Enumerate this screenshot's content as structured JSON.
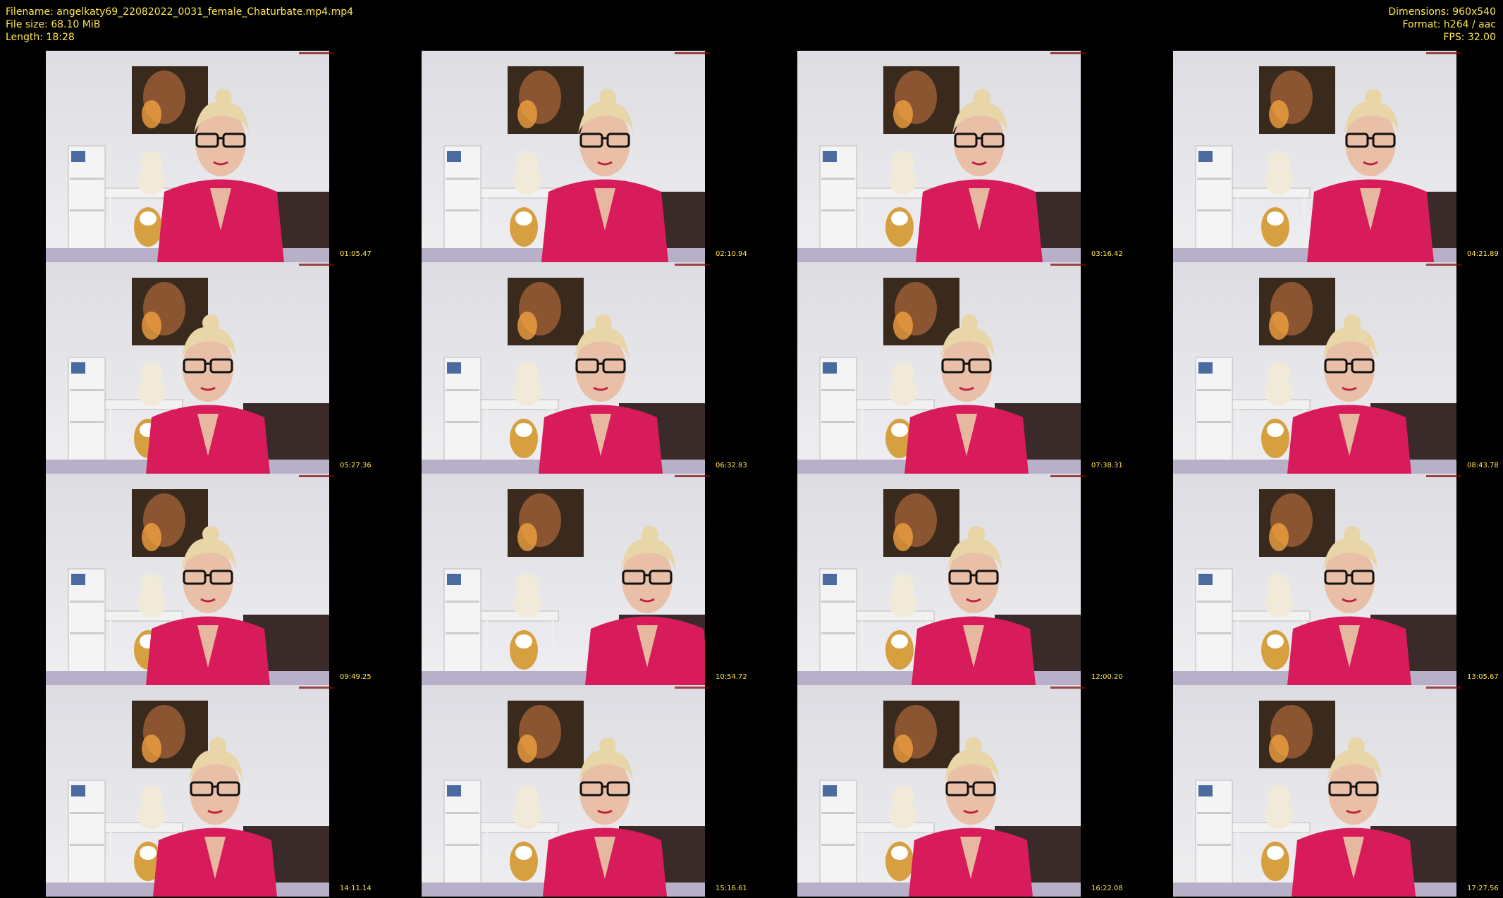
{
  "info": {
    "filename": "Filename: angelkaty69_22082022_0031_female_Chaturbate.mp4.mp4",
    "filesize": "File size: 68.10 MiB",
    "length": "Length: 18:28",
    "dimensions": "Dimensions: 960x540",
    "format": "Format: h264 / aac",
    "fps": "FPS: 32.00"
  },
  "thumbnails": [
    {
      "timestamp": "01:05.47"
    },
    {
      "timestamp": "02:10.94"
    },
    {
      "timestamp": "03:16.42"
    },
    {
      "timestamp": "04:21.89"
    },
    {
      "timestamp": "05:27.36"
    },
    {
      "timestamp": "06:32.83"
    },
    {
      "timestamp": "07:38.31"
    },
    {
      "timestamp": "08:43.78"
    },
    {
      "timestamp": "09:49.25"
    },
    {
      "timestamp": "10:54.72"
    },
    {
      "timestamp": "12:00.20"
    },
    {
      "timestamp": "13:05.67"
    },
    {
      "timestamp": "14:11.14"
    },
    {
      "timestamp": "15:16.61"
    },
    {
      "timestamp": "16:22.08"
    },
    {
      "timestamp": "17:27.56"
    }
  ],
  "colors": {
    "background": "#000000",
    "text": "#ffe74a",
    "jacket": "#d81b5a"
  }
}
